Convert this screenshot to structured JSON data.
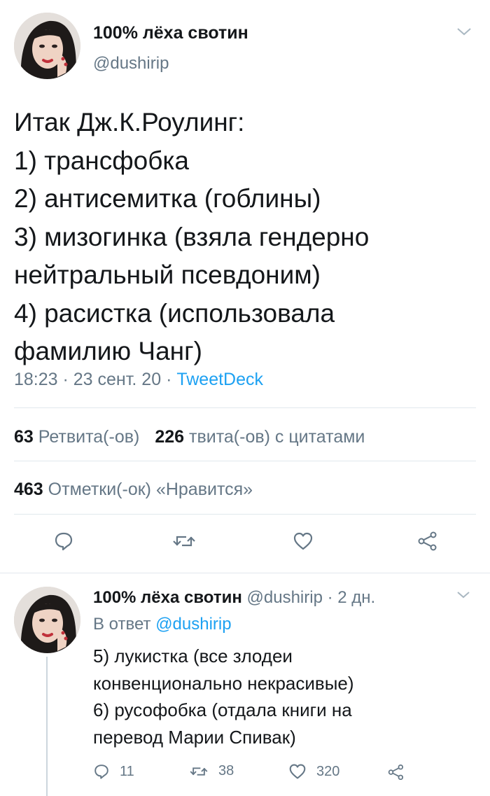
{
  "tweet": {
    "author": {
      "name": "100% лёха свотин",
      "handle": "@dushirip",
      "avatar_icon": "profile-photo"
    },
    "text_lines": [
      "Итак Дж.К.Роулинг:",
      "1) трансфобка",
      "2) антисемитка (гоблины)",
      "3) мизогинка (взяла гендерно",
      "нейтральный псевдоним)",
      "4) расистка (использовала",
      "фамилию Чанг)"
    ],
    "meta": {
      "time_date": "18:23 · 23 сент. 20 · ",
      "source": "TweetDeck"
    },
    "stats": {
      "retweets_count": "63",
      "retweets_label": "Ретвита(-ов)",
      "quotes_count": "226",
      "quotes_label": "твита(-ов) с цитатами",
      "likes_count": "463",
      "likes_label": "Отметки(-ок) «Нравится»"
    },
    "actions": [
      "reply-icon",
      "retweet-icon",
      "like-icon",
      "share-icon"
    ]
  },
  "reply": {
    "author": {
      "name": "100% лёха свотин",
      "handle_time": " @dushirip · 2 дн.",
      "avatar_icon": "profile-photo"
    },
    "reply_to_prefix": "В ответ ",
    "reply_to_handle": "@dushirip",
    "text_lines": [
      "5) лукистка (все злодеи",
      "конвенционально некрасивые)",
      "6) русофобка (отдала книги на",
      "перевод Марии Спивак)"
    ],
    "actions": {
      "reply_count": "11",
      "retweet_count": "38",
      "like_count": "320"
    }
  },
  "colors": {
    "text": "#14171a",
    "secondary": "#657786",
    "link": "#1da1f2",
    "divider": "#e1e8ed"
  }
}
